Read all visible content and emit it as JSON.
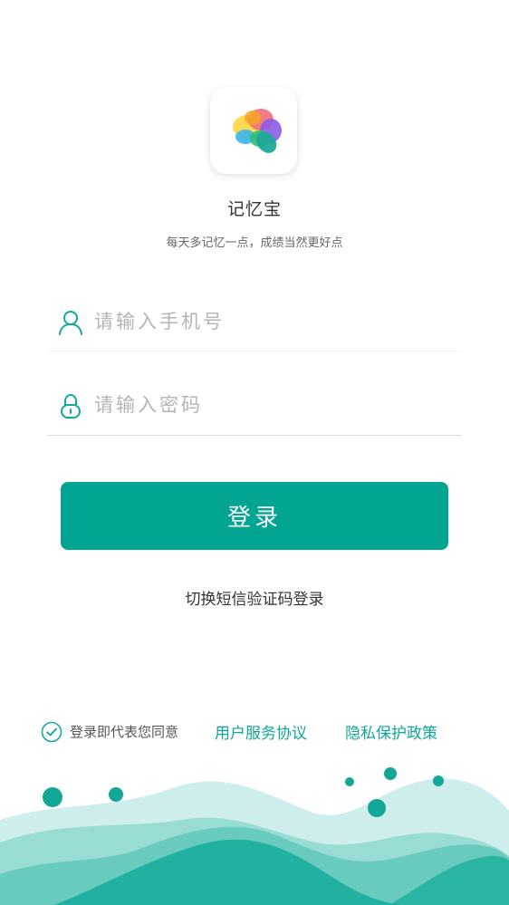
{
  "app": {
    "name": "记忆宝",
    "slogan": "每天多记忆一点，成绩当然更好点",
    "logo_icon": "brain-icon"
  },
  "form": {
    "phone_placeholder": "请输入手机号",
    "phone_value": "",
    "phone_icon": "user-icon",
    "password_placeholder": "请输入密码",
    "password_value": "",
    "password_icon": "lock-icon"
  },
  "actions": {
    "login_label": "登录",
    "switch_sms_label": "切换短信验证码登录"
  },
  "agreement": {
    "prefix": "登录即代表您同意",
    "user_agreement": "用户服务协议",
    "privacy_policy": "隐私保护政策",
    "checked": true
  },
  "colors": {
    "primary": "#01a592",
    "link": "#11a797",
    "placeholder": "#b4b4b4",
    "wave_light": "#cdeeec",
    "wave_mid": "#8ed8cf",
    "wave_dark": "#1aae9c"
  }
}
